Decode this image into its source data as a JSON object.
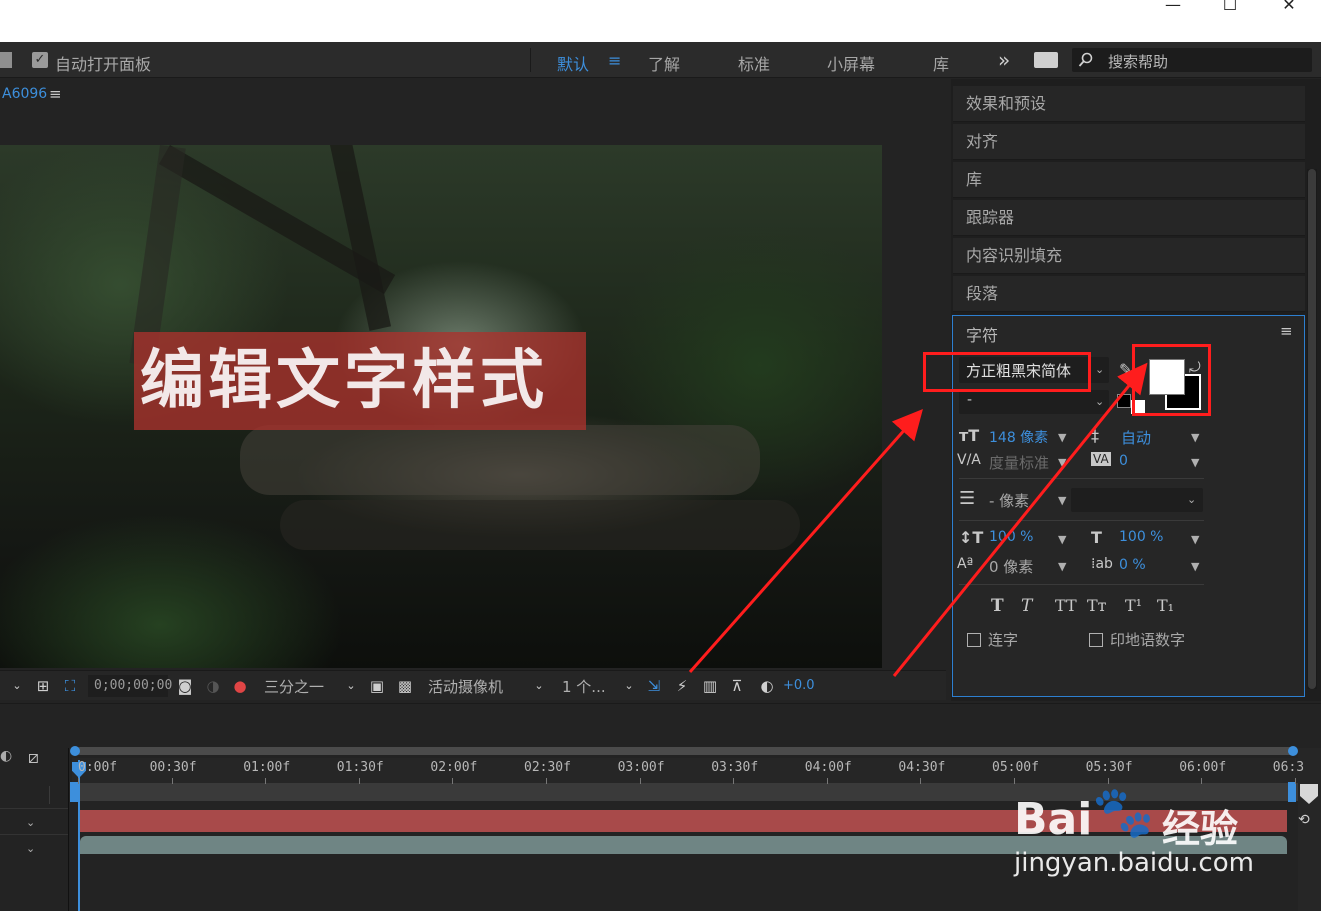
{
  "window": {
    "minimize_icon": "minimize-icon",
    "maximize_icon": "maximize-icon",
    "close_icon": "close-icon",
    "minimize_glyph": "—",
    "maximize_glyph": "☐",
    "close_glyph": "✕"
  },
  "toolbar": {
    "auto_open_label": "自动打开面板",
    "auto_open_checked": true,
    "workspaces": [
      {
        "label": "默认",
        "active": true
      },
      {
        "label": "了解",
        "active": false
      },
      {
        "label": "标准",
        "active": false
      },
      {
        "label": "小屏幕",
        "active": false
      },
      {
        "label": "库",
        "active": false
      }
    ],
    "workspace_menu_glyph": "≡",
    "overflow_glyph": "»",
    "search_placeholder": "搜索帮助"
  },
  "composition": {
    "name": "A6096",
    "menu_glyph": "≡",
    "overlay_text": "编辑文字样式",
    "footer": {
      "timecode": "0;00;00;00",
      "grid_option": "三分之一",
      "camera": "活动摄像机",
      "views": "1 个...",
      "exposure": "+0.0"
    }
  },
  "right_panels": {
    "items": [
      "效果和预设",
      "对齐",
      "库",
      "跟踪器",
      "内容识别填充",
      "段落"
    ]
  },
  "character": {
    "title": "字符",
    "menu_glyph": "≡",
    "font_family": "方正粗黑宋简体",
    "font_style": "-",
    "font_size": "148 像素",
    "leading": "自动",
    "kerning": "度量标准",
    "tracking": "0",
    "stroke_width": "- 像素",
    "vertical_scale": "100 %",
    "horizontal_scale": "100 %",
    "baseline_shift": "0 像素",
    "tsume": "0 %",
    "style_buttons": [
      "T",
      "T",
      "TT",
      "Tт",
      "T¹",
      "T₁"
    ],
    "ligature_label": "连字",
    "hindi_digits_label": "印地语数字",
    "fill_color": "#ffffff",
    "stroke_color": "#000000"
  },
  "timeline": {
    "ticks": [
      "0:00f",
      "00:30f",
      "01:00f",
      "01:30f",
      "02:00f",
      "02:30f",
      "03:00f",
      "03:30f",
      "04:00f",
      "04:30f",
      "05:00f",
      "05:30f",
      "06:00f",
      "06:3"
    ]
  },
  "watermark": {
    "brand": "Bai",
    "brand_suffix": "经验",
    "url": "jingyan.baidu.com"
  },
  "colors": {
    "accent": "#3d8fdc",
    "annotation": "#ff1d1d",
    "track_red": "#a84a4a",
    "track_teal": "#6f8584"
  }
}
